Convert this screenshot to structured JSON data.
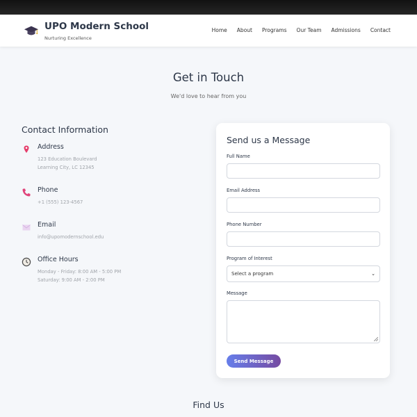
{
  "brand": {
    "title": "UPO Modern School",
    "tagline": "Nurturing Excellence",
    "logo_icon": "graduation-cap-icon"
  },
  "nav": {
    "items": [
      "Home",
      "About",
      "Programs",
      "Our Team",
      "Admissions",
      "Contact"
    ]
  },
  "hero": {
    "title": "Get in Touch",
    "subtitle": "We'd love to hear from you"
  },
  "contact_info": {
    "heading": "Contact Information",
    "address": {
      "icon": "map-pin-icon",
      "title": "Address",
      "lines": [
        "123 Education Boulevard",
        "Learning City, LC 12345"
      ]
    },
    "phone": {
      "icon": "phone-icon",
      "title": "Phone",
      "lines": [
        "+1 (555) 123-4567"
      ]
    },
    "email": {
      "icon": "envelope-icon",
      "title": "Email",
      "lines": [
        "info@upomodernschool.edu"
      ]
    },
    "hours": {
      "icon": "clock-icon",
      "title": "Office Hours",
      "lines": [
        "Monday - Friday: 8:00 AM - 5:00 PM",
        "Saturday: 9:00 AM - 2:00 PM"
      ]
    }
  },
  "form": {
    "title": "Send us a Message",
    "full_name_label": "Full Name",
    "full_name_value": "",
    "email_label": "Email Address",
    "email_value": "",
    "phone_label": "Phone Number",
    "phone_value": "",
    "program_label": "Program of Interest",
    "program_selected": "Select a program",
    "message_label": "Message",
    "message_value": "",
    "submit_label": "Send Message"
  },
  "find_us": {
    "title": "Find Us"
  },
  "colors": {
    "accent_start": "#667eea",
    "accent_end": "#764ba2",
    "page_bg": "#f5f7fa"
  }
}
